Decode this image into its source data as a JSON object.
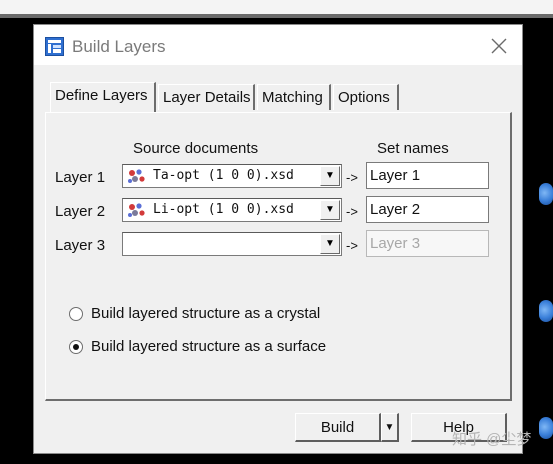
{
  "window": {
    "title": "Build Layers"
  },
  "icons": {
    "app": "build-layers-icon",
    "close": "close-icon",
    "document": "structure-document-icon",
    "dropdown": "dropdown-arrow-icon"
  },
  "tabs": [
    {
      "label": "Define Layers",
      "active": true
    },
    {
      "label": "Layer Details",
      "active": false
    },
    {
      "label": "Matching",
      "active": false
    },
    {
      "label": "Options",
      "active": false
    }
  ],
  "define_layers": {
    "source_header": "Source documents",
    "setnames_header": "Set names",
    "arrow_text": "->",
    "layers": [
      {
        "label": "Layer 1",
        "source": "Ta-opt (1 0 0).xsd",
        "set_name": "Layer 1",
        "enabled": true
      },
      {
        "label": "Layer 2",
        "source": "Li-opt (1 0 0).xsd",
        "set_name": "Layer 2",
        "enabled": true
      },
      {
        "label": "Layer 3",
        "source": "",
        "set_name": "Layer 3",
        "enabled": false
      }
    ],
    "radio_crystal": {
      "label": "Build layered structure as a crystal",
      "checked": false
    },
    "radio_surface": {
      "label": "Build layered structure as a surface",
      "checked": true
    }
  },
  "buttons": {
    "build": "Build",
    "help": "Help",
    "dropdown_glyph": "▼"
  },
  "watermark": "知乎 @尘梦"
}
